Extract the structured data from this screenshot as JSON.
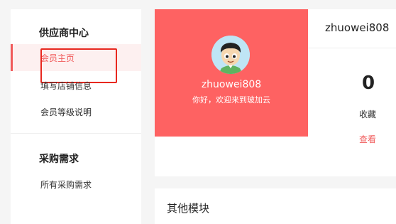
{
  "sidebar": {
    "supplier_section": {
      "title": "供应商中心",
      "items": [
        {
          "label": "会员主页",
          "active": true
        },
        {
          "label": "填写店铺信息"
        },
        {
          "label": "会员等级说明"
        }
      ]
    },
    "purchase_section": {
      "title": "采购需求",
      "items": [
        {
          "label": "所有采购需求"
        }
      ]
    }
  },
  "profile": {
    "username": "zhuowei808",
    "welcome": "你好，欢迎来到玻加云",
    "avatar_icon": "cartoon-boy-avatar"
  },
  "stats": {
    "username": "zhuowei808",
    "favorites_count": "0",
    "favorites_label": "收藏",
    "view_link": "查看"
  },
  "other": {
    "title": "其他模块"
  },
  "colors": {
    "accent": "#f15b5b",
    "card_bg": "#fe6262",
    "highlight_border": "#e8281f"
  }
}
